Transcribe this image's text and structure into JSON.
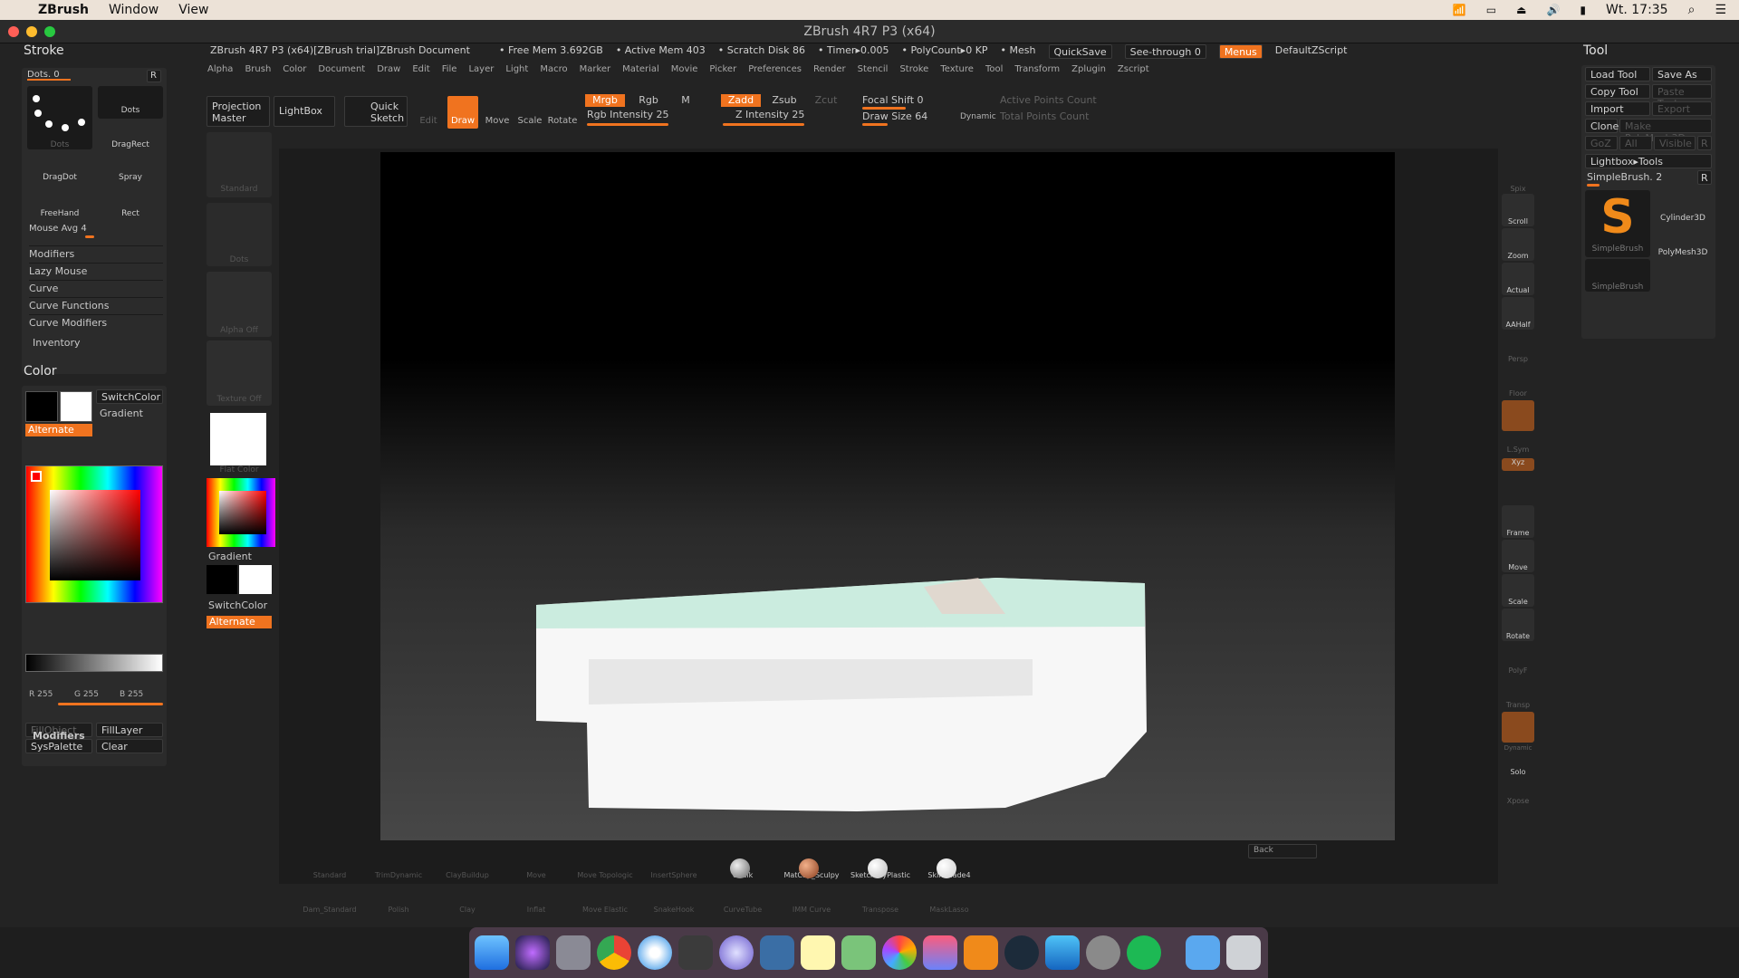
{
  "macbar": {
    "app": "ZBrush",
    "menus": [
      "Window",
      "View"
    ],
    "clock": "Wt. 17:35"
  },
  "window_title": "ZBrush 4R7 P3 (x64)",
  "infobar": {
    "doc": "ZBrush 4R7 P3 (x64)[ZBrush trial]ZBrush Document",
    "free_mem": "• Free Mem 3.692GB",
    "active_mem": "• Active Mem 403",
    "scratch": "• Scratch Disk 86",
    "timer": "• Timer▸0.005",
    "polycount": "• PolyCount▸0 KP",
    "mesh": "• Mesh",
    "quicksave": "QuickSave",
    "see_through": "See-through  0",
    "menus": "Menus",
    "script": "DefaultZScript"
  },
  "menubar": [
    "Alpha",
    "Brush",
    "Color",
    "Document",
    "Draw",
    "Edit",
    "File",
    "Layer",
    "Light",
    "Macro",
    "Marker",
    "Material",
    "Movie",
    "Picker",
    "Preferences",
    "Render",
    "Stencil",
    "Stroke",
    "Texture",
    "Tool",
    "Transform",
    "Zplugin",
    "Zscript"
  ],
  "toolbar": {
    "projection_master": "Projection Master",
    "lightbox": "LightBox",
    "quick_sketch": "Quick Sketch",
    "edit": "Edit",
    "draw": "Draw",
    "move": "Move",
    "scale": "Scale",
    "rotate": "Rotate",
    "mrgb": "Mrgb",
    "rgb": "Rgb",
    "m": "M",
    "rgb_intensity": "Rgb Intensity 25",
    "zadd": "Zadd",
    "zsub": "Zsub",
    "zcut": "Zcut",
    "z_intensity": "Z Intensity 25",
    "focal_shift": "Focal Shift 0",
    "draw_size": "Draw Size 64",
    "dynamic": "Dynamic",
    "active_points": "Active Points Count",
    "total_points": "Total Points Count"
  },
  "stroke_panel": {
    "title": "Stroke",
    "dots_label": "Dots. 0",
    "r": "R",
    "items": [
      "Dots",
      "Dots",
      "DragRect",
      "DragDot",
      "Spray",
      "FreeHand",
      "Rect"
    ],
    "mouse_avg": "Mouse Avg 4",
    "sections": [
      "Modifiers",
      "Lazy Mouse",
      "Curve",
      "Curve Functions",
      "Curve Modifiers"
    ],
    "inventory": "Inventory"
  },
  "color_panel": {
    "title": "Color",
    "switchcolor": "SwitchColor",
    "gradient": "Gradient",
    "alternate": "Alternate",
    "r": "R 255",
    "g": "G 255",
    "b": "B 255",
    "fillobject": "FillObject",
    "filllayer": "FillLayer",
    "syspalette": "SysPalette",
    "clear": "Clear",
    "modifiers": "Modifiers"
  },
  "left_shelf": {
    "standard": "Standard",
    "dots": "Dots",
    "alpha": "Alpha Off",
    "texture": "Texture Off",
    "flat_color": "Flat Color",
    "gradient": "Gradient",
    "switchcolor": "SwitchColor",
    "alternate": "Alternate"
  },
  "right_shelf": [
    "Spix",
    "Scroll",
    "Zoom",
    "Actual",
    "AAHalf",
    "Persp",
    "Floor",
    "Local",
    "L.Sym",
    "Xyz",
    "Frame",
    "Move",
    "Scale",
    "Rotate",
    "PolyF",
    "Transp",
    "Dynamic",
    "Solo",
    "Xpose"
  ],
  "tool_panel": {
    "title": "Tool",
    "load": "Load Tool",
    "save": "Save As",
    "copy": "Copy Tool",
    "paste": "Paste Tool",
    "import": "Import",
    "export": "Export",
    "clone": "Clone",
    "make": "Make PolyMesh3D",
    "goz": "GoZ",
    "all": "All",
    "visible": "Visible",
    "r": "R",
    "lightbox_tools": "Lightbox▸Tools",
    "current": "SimpleBrush. 2",
    "r2": "R",
    "items": [
      "SimpleBrush",
      "Cylinder3D",
      "PolyMesh3D",
      "SimpleBrush"
    ]
  },
  "brush_shelf": {
    "top": [
      "Standard",
      "TrimDynamic",
      "ClayBuildup",
      "Move",
      "Move Topologic",
      "InsertSphere",
      "Chalk",
      "MatCap_Sculpy",
      "SketchToyPlastic",
      "SkinShade4"
    ],
    "bottom": [
      "Dam_Standard",
      "Polish",
      "Clay",
      "Inflat",
      "Move Elastic",
      "SnakeHook",
      "CurveTube",
      "IMM Curve",
      "Transpose",
      "MaskLasso"
    ],
    "back": "Back"
  },
  "colors": {
    "accent": "#f0731f",
    "bg": "#232323"
  }
}
